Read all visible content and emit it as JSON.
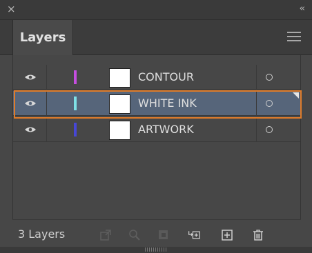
{
  "window": {
    "close_glyph": "×",
    "collapse_glyph": "‹‹"
  },
  "tabs": [
    {
      "label": "Layers",
      "active": true
    }
  ],
  "panel_menu_icon": "hamburger-menu-icon",
  "layers": [
    {
      "name": "CONTOUR",
      "color": "#c64ee0",
      "visible": true,
      "selected": false
    },
    {
      "name": "WHITE INK",
      "color": "#7fe0e6",
      "visible": true,
      "selected": true
    },
    {
      "name": "ARTWORK",
      "color": "#4747d6",
      "visible": true,
      "selected": false
    }
  ],
  "footer": {
    "layer_count": "3 Layers",
    "icons": [
      {
        "name": "export-for-screens-icon",
        "enabled": false
      },
      {
        "name": "locate-object-icon",
        "enabled": false
      },
      {
        "name": "make-clipping-mask-icon",
        "enabled": false
      },
      {
        "name": "create-new-sublayer-icon",
        "enabled": true
      },
      {
        "name": "create-new-layer-icon",
        "enabled": true
      },
      {
        "name": "delete-layer-icon",
        "enabled": true
      }
    ]
  },
  "colors": {
    "selection_row": "#56657a",
    "highlight_outline": "#e07c2a"
  }
}
